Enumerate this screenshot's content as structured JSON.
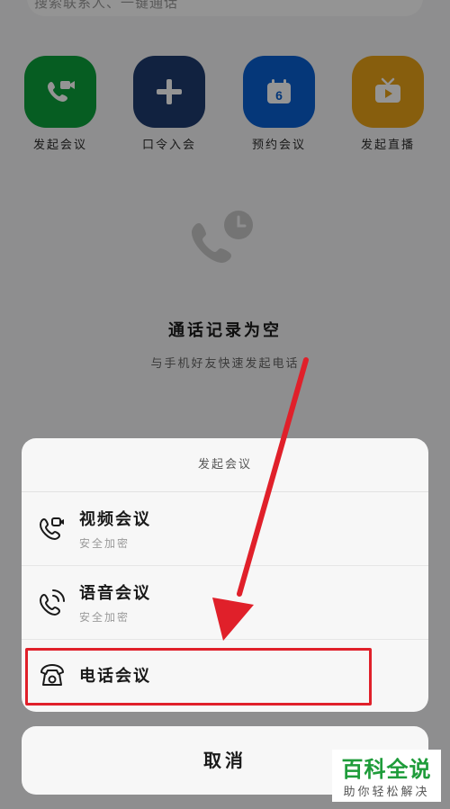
{
  "search": {
    "text": "搜索联系人、一键通话"
  },
  "actions": [
    {
      "label": "发起会议",
      "icon": "video-call-icon",
      "color": "#0ca03c"
    },
    {
      "label": "口令入会",
      "icon": "plus-icon",
      "color": "#1e3c6e"
    },
    {
      "label": "预约会议",
      "icon": "calendar-icon",
      "color": "#0a5fd1",
      "calendar_day": "6"
    },
    {
      "label": "发起直播",
      "icon": "tv-icon",
      "color": "#e8a317"
    }
  ],
  "empty_state": {
    "icon": "phone-clock-icon",
    "title": "通话记录为空",
    "subtitle": "与手机好友快速发起电话"
  },
  "sheet": {
    "title": "发起会议",
    "options": [
      {
        "name": "视频会议",
        "subtitle": "安全加密",
        "icon": "video-phone-icon"
      },
      {
        "name": "语音会议",
        "subtitle": "安全加密",
        "icon": "voice-phone-icon"
      },
      {
        "name": "电话会议",
        "subtitle": "",
        "icon": "telephone-icon"
      }
    ],
    "cancel_label": "取消"
  },
  "annotation": {
    "highlight_color": "#e0202a"
  },
  "watermark": {
    "main": "百科全说",
    "sub": "助你轻松解决"
  }
}
